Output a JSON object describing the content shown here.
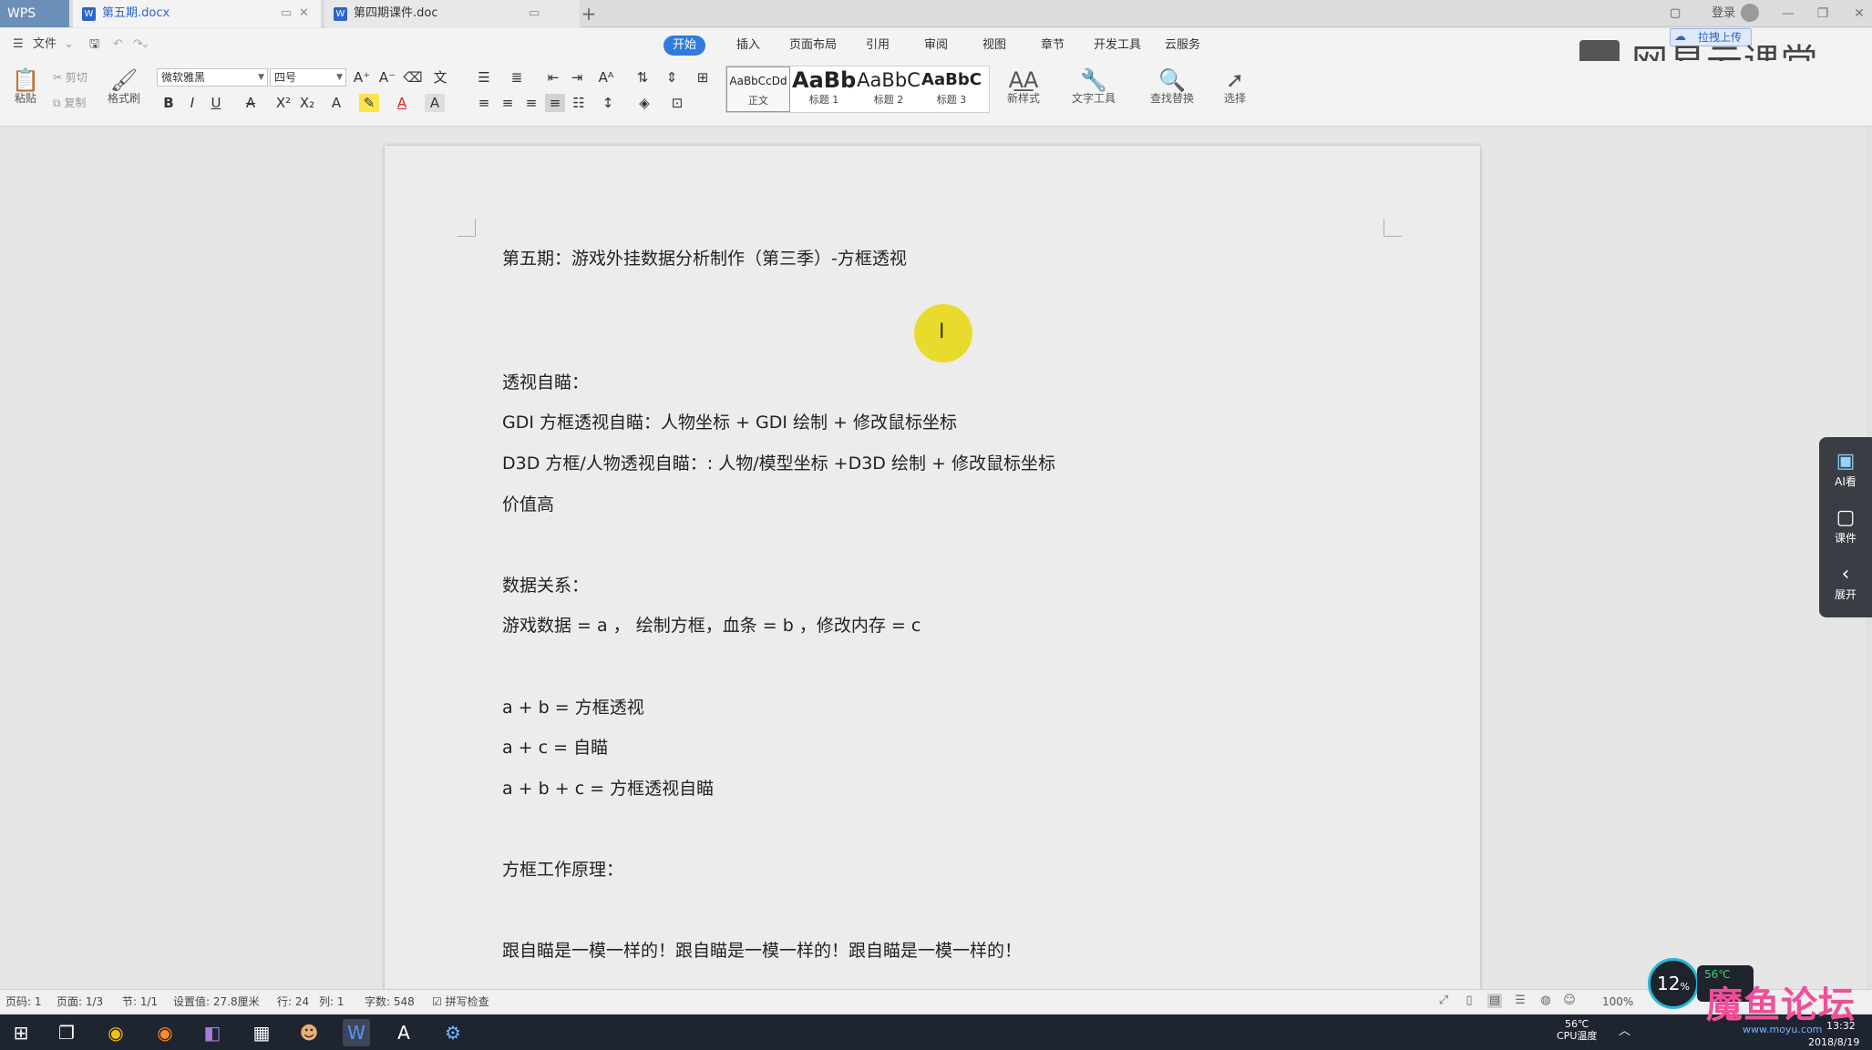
{
  "tabs": {
    "app_name": "WPS",
    "active_doc": "第五期.docx",
    "second_doc": "第四期课件.doc",
    "word_icon": "W"
  },
  "topbar": {
    "login": "登录",
    "upload": "拉拽上传",
    "brand": "网易云课堂"
  },
  "menu": {
    "file": "文件",
    "items": [
      "开始",
      "插入",
      "页面布局",
      "引用",
      "审阅",
      "视图",
      "章节",
      "开发工具",
      "云服务"
    ]
  },
  "ribbon": {
    "paste": "粘贴",
    "cut": "剪切",
    "copy": "复制",
    "format_painter": "格式刷",
    "font": "微软雅黑",
    "size": "四号",
    "styles": [
      {
        "preview": "AaBbCcDd",
        "name": "正文"
      },
      {
        "preview": "AaBb",
        "name": "标题 1"
      },
      {
        "preview": "AaBbC",
        "name": "标题 2"
      },
      {
        "preview": "AaBbC",
        "name": "标题 3"
      }
    ],
    "new_style": "新样式",
    "text_tools": "文字工具",
    "find_replace": "查找替换",
    "select": "选择"
  },
  "document": {
    "lines": [
      "第五期：游戏外挂数据分析制作（第三季）-方框透视",
      "透视自瞄：",
      "GDI 方框透视自瞄：人物坐标 + GDI 绘制 + 修改鼠标坐标",
      "D3D 方框/人物透视自瞄：: 人物/模型坐标 +D3D 绘制 + 修改鼠标坐标",
      "价值高",
      "数据关系：",
      "游戏数据 = a ， 绘制方框，血条 = b ，修改内存 = c",
      "a + b  = 方框透视",
      "a + c  = 自瞄",
      "a + b + c  = 方框透视自瞄",
      "方框工作原理：",
      "跟自瞄是一模一样的！跟自瞄是一模一样的！跟自瞄是一模一样的！"
    ]
  },
  "side_panel": {
    "ai": "AI看",
    "courseware": "课件",
    "expand": "展开"
  },
  "status": {
    "page_no": "页码: 1",
    "pages": "页面: 1/3",
    "section": "节: 1/1",
    "setting": "设置值: 27.8厘米",
    "row": "行: 24",
    "col": "列: 1",
    "words": "字数: 548",
    "spell": "拼写检查",
    "zoom": "100%"
  },
  "taskbar": {
    "cpu_percent": "12",
    "cpu_temp": "56℃",
    "cpu_label": "CPU温度",
    "temp_small": "56℃",
    "time": "13:32",
    "date": "2018/8/19",
    "watermark": "魔鱼论坛",
    "watermark_sub": "www.moyu.com"
  },
  "icons": [
    "paste-icon",
    "cut-icon",
    "copy-icon",
    "format-painter-icon",
    "search-icon",
    "cursor-icon",
    "windows-start-icon"
  ]
}
